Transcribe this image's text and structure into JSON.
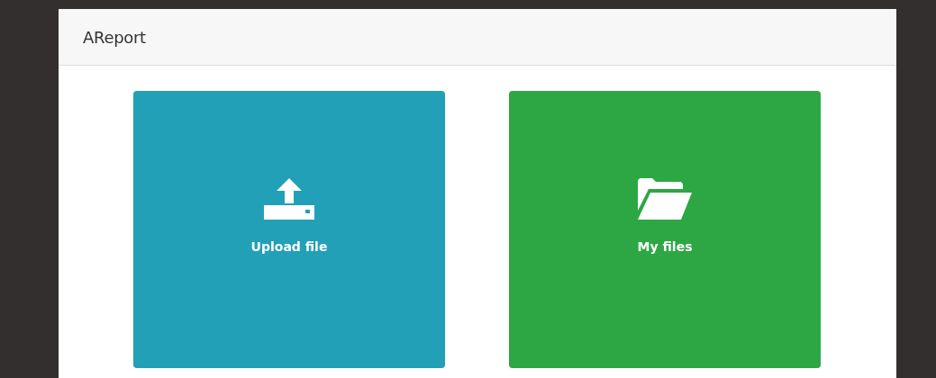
{
  "header": {
    "title": "AReport"
  },
  "tiles": [
    {
      "label": "Upload file",
      "kind": "upload",
      "color": "#22a0b8"
    },
    {
      "label": "My files",
      "kind": "folder",
      "color": "#2ca744"
    }
  ]
}
